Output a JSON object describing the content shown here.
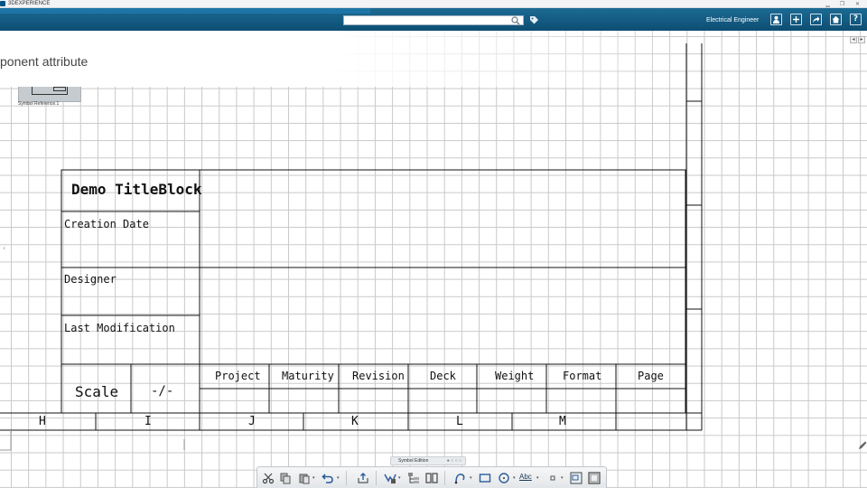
{
  "window": {
    "app_title": "3DEXPERIENCE",
    "minimize_glyph": "▁",
    "restore_glyph": "❐",
    "close_glyph": "✕"
  },
  "topbar": {
    "search_placeholder": "",
    "user_role": "Electrical Engineer",
    "icons": [
      "user-icon",
      "add-icon",
      "share-icon",
      "home-icon",
      "help-icon"
    ],
    "help_glyph": "?"
  },
  "banner": {
    "text": "ponent attribute"
  },
  "symbol": {
    "label": "Symbol Reference.1"
  },
  "title_block": {
    "title": "Demo TitleBlock",
    "rows": [
      "Creation Date",
      "Designer",
      "Last Modification"
    ],
    "scale_label": "Scale",
    "scale_value": "-/-",
    "columns": [
      "Project",
      "Maturity",
      "Revision",
      "Deck",
      "Weight",
      "Format",
      "Page"
    ]
  },
  "zone_letters": [
    "H",
    "I",
    "J",
    "K",
    "L",
    "M"
  ],
  "panel_arrows": {
    "left": "◂",
    "right": "▸",
    "side": "‹"
  },
  "bottom_toolbar": {
    "label": "Symbol Edition",
    "dots": "● ○ ○ ○",
    "abc_text": "Abc",
    "tools": [
      "cut-icon",
      "copy-icon",
      "paste-icon",
      "undo-icon",
      "export-icon",
      "select-icon",
      "tree-icon",
      "split-icon",
      "curve-icon",
      "rectangle-icon",
      "circle-icon",
      "text-icon",
      "point-icon",
      "frame-icon",
      "box-icon"
    ]
  },
  "colors": {
    "topbar": "#0d4e72",
    "grid": "#c9c9c9",
    "line": "#111111"
  }
}
